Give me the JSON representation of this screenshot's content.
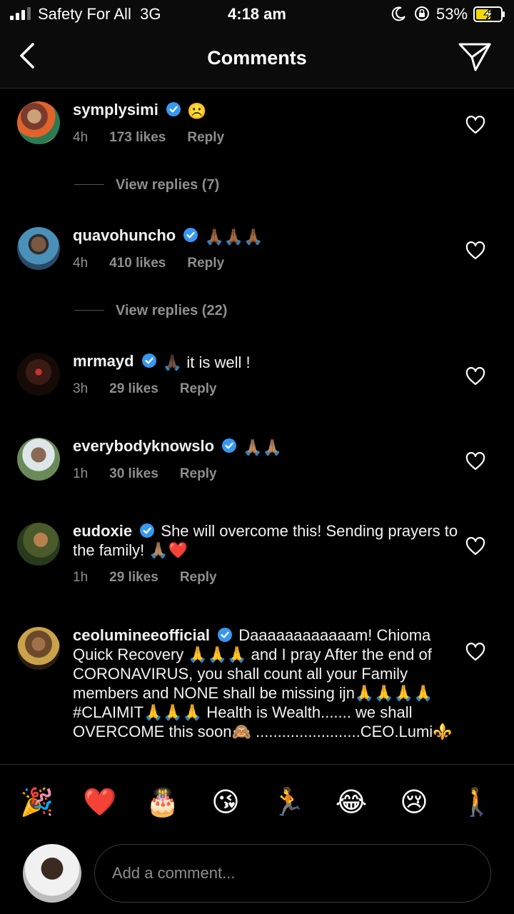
{
  "status_bar": {
    "carrier": "Safety For All",
    "network": "3G",
    "time": "4:18 am",
    "battery": "53%"
  },
  "header": {
    "title": "Comments"
  },
  "comments": [
    {
      "user": "symplysimi",
      "text": "☹️",
      "time": "4h",
      "likes": "173 likes",
      "reply": "Reply",
      "view_replies": "View replies (7)"
    },
    {
      "user": "quavohuncho",
      "text": "🙏🏾🙏🏾🙏🏾",
      "time": "4h",
      "likes": "410 likes",
      "reply": "Reply",
      "view_replies": "View replies (22)"
    },
    {
      "user": "mrmayd",
      "text": "🙏🏿 it is well !",
      "time": "3h",
      "likes": "29 likes",
      "reply": "Reply"
    },
    {
      "user": "everybodyknowslo",
      "text": "🙏🏽🙏🏽",
      "time": "1h",
      "likes": "30 likes",
      "reply": "Reply"
    },
    {
      "user": "eudoxie",
      "text": "She will overcome this! Sending prayers to the family! 🙏🏽❤️",
      "time": "1h",
      "likes": "29 likes",
      "reply": "Reply"
    },
    {
      "user": "ceolumineeofficial",
      "text": "Daaaaaaaaaaaam! Chioma Quick Recovery 🙏🙏🙏 and I pray After the end of CORONAVIRUS,  you shall count all your Family members and NONE shall be missing ijn🙏🙏🙏🙏 #CLAIMIT🙏🙏🙏 Health is Wealth....... we shall OVERCOME this soon🙈 ........................CEO.Lumi⚜️"
    }
  ],
  "emoji_bar": [
    "🎉",
    "❤️",
    "🎂",
    "😘",
    "🏃",
    "😂",
    "😢",
    "🚶"
  ],
  "composer": {
    "placeholder": "Add a comment..."
  },
  "colors": {
    "background": "#000000",
    "muted": "#8e8e8e",
    "verified": "#3897f0"
  }
}
